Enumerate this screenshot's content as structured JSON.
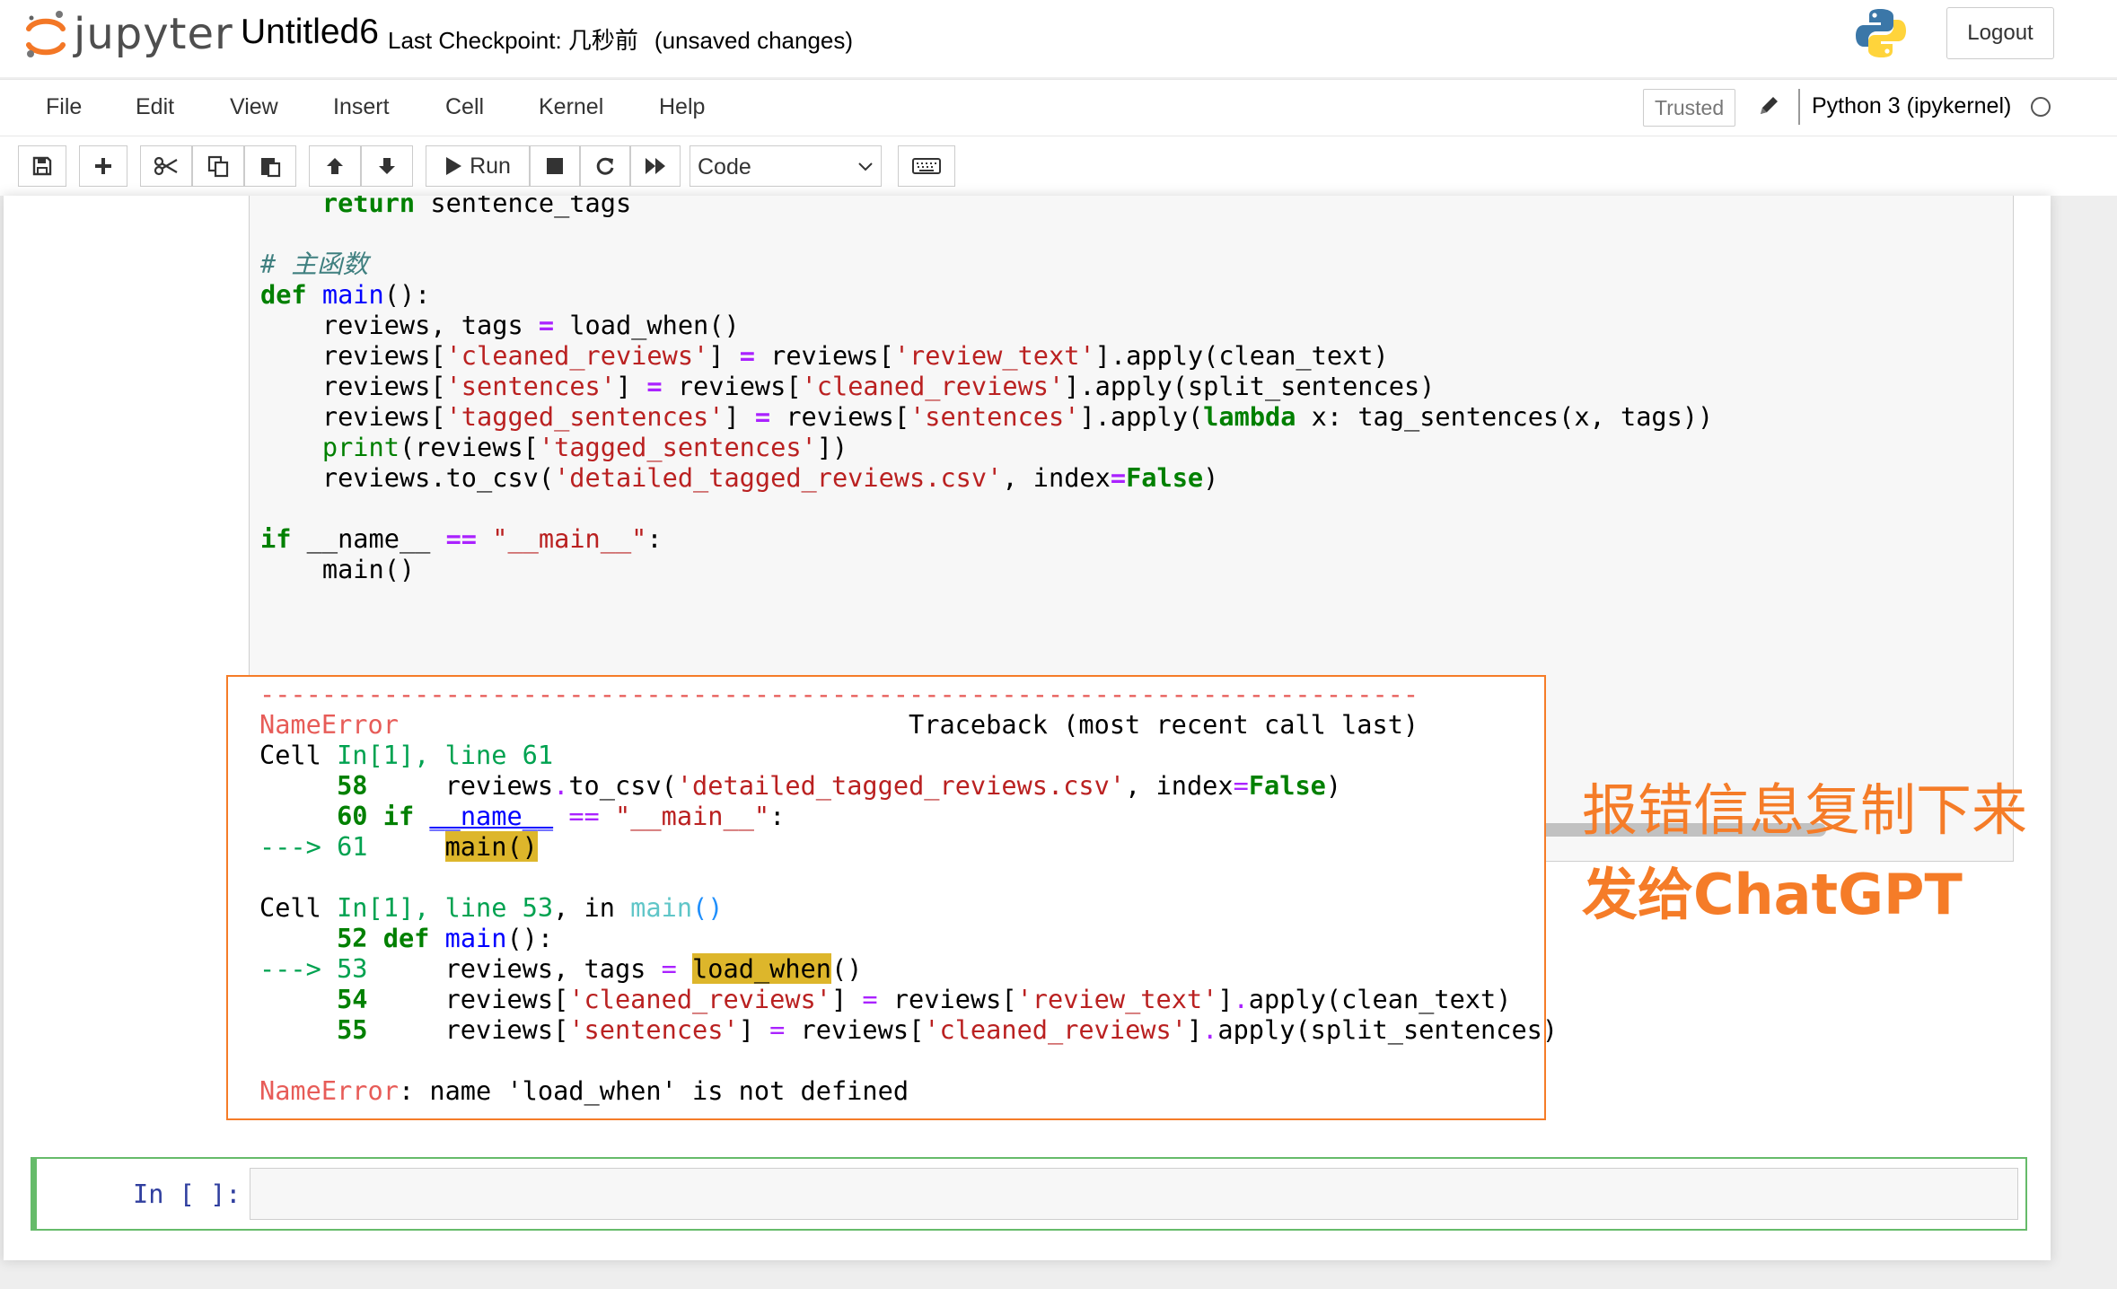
{
  "header": {
    "logo_text": "jupyter",
    "notebook_title": "Untitled6",
    "checkpoint_label": "Last Checkpoint: 几秒前",
    "unsaved": "(unsaved changes)",
    "logout_label": "Logout"
  },
  "menubar": {
    "items": [
      "File",
      "Edit",
      "View",
      "Insert",
      "Cell",
      "Kernel",
      "Help"
    ],
    "trusted_label": "Trusted",
    "kernel_name": "Python 3 (ipykernel)"
  },
  "toolbar": {
    "run_label": "Run",
    "cell_type": "Code",
    "icons": [
      "save-icon",
      "plus-icon",
      "cut-icon",
      "copy-icon",
      "paste-icon",
      "arrow-up-icon",
      "arrow-down-icon",
      "play-icon",
      "stop-icon",
      "restart-icon",
      "fast-forward-icon",
      "keyboard-icon"
    ]
  },
  "code_cell": {
    "lines": [
      "    return sentence_tags",
      "",
      "# 主函数",
      "def main():",
      "    reviews, tags = load_when()",
      "    reviews['cleaned_reviews'] = reviews['review_text'].apply(clean_text)",
      "    reviews['sentences'] = reviews['cleaned_reviews'].apply(split_sentences)",
      "    reviews['tagged_sentences'] = reviews['sentences'].apply(lambda x: tag_sentences(x, tags))",
      "    print(reviews['tagged_sentences'])",
      "    reviews.to_csv('detailed_tagged_reviews.csv', index=False)",
      "",
      "if __name__ == \"__main__\":",
      "    main()"
    ]
  },
  "traceback": {
    "separator": "---------------------------------------------------------------------------",
    "error_type": "NameError",
    "header_right": "Traceback (most recent call last)",
    "lines": [
      "Cell In[1], line 61",
      "     58     reviews.to_csv('detailed_tagged_reviews.csv', index=False)",
      "     60 if __name__ == \"__main__\":",
      "---> 61     main()",
      "",
      "Cell In[1], line 53, in main()",
      "     52 def main():",
      "---> 53     reviews, tags = load_when()",
      "     54     reviews['cleaned_reviews'] = reviews['review_text'].apply(clean_text)",
      "     55     reviews['sentences'] = reviews['cleaned_reviews'].apply(split_sentences)",
      "",
      "NameError: name 'load_when' is not defined"
    ]
  },
  "annotation": {
    "line1": "报错信息复制下来",
    "line2": "发给ChatGPT"
  },
  "input_cell": {
    "prompt": "In [ ]:"
  },
  "colors": {
    "accent_orange": "#f57c28",
    "selected_cell_border": "#66bb6a",
    "prompt_blue": "#303f9f",
    "highlight": "#ddb62b"
  }
}
